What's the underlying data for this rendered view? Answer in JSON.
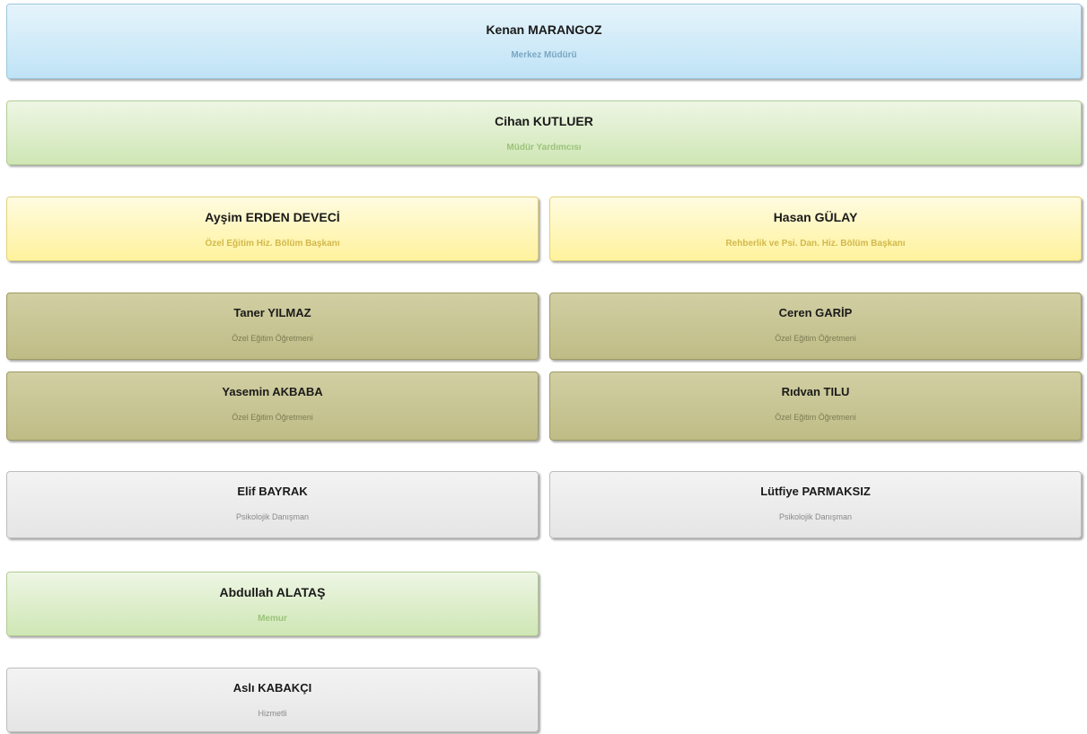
{
  "staff": [
    {
      "name": "Kenan MARANGOZ",
      "role": "Merkez Müdürü"
    },
    {
      "name": "Cihan KUTLUER",
      "role": "Müdür Yardımcısı"
    },
    {
      "name": "Ayşim ERDEN DEVECİ",
      "role": "Özel Eğitim Hiz. Bölüm Başkanı"
    },
    {
      "name": "Hasan GÜLAY",
      "role": "Rehberlik ve Psi. Dan. Hiz. Bölüm Başkanı"
    },
    {
      "name": "Taner YILMAZ",
      "role": "Özel Eğitim Öğretmeni"
    },
    {
      "name": "Ceren GARİP",
      "role": "Özel Eğitim Öğretmeni"
    },
    {
      "name": "Yasemin AKBABA",
      "role": "Özel Eğitim Öğretmeni"
    },
    {
      "name": "Rıdvan TILU",
      "role": "Özel Eğitim Öğretmeni"
    },
    {
      "name": "Elif BAYRAK",
      "role": "Psikolojik Danışman"
    },
    {
      "name": "Lütfiye PARMAKSIZ",
      "role": "Psikolojik Danışman"
    },
    {
      "name": "Abdullah ALATAŞ",
      "role": "Memur"
    },
    {
      "name": "Aslı KABAKÇI",
      "role": "Hizmetli"
    }
  ],
  "colors": {
    "director": "#bfe3f6",
    "assistant": "#cfe6b5",
    "department_head": "#fff29d",
    "teacher": "#bfbc86",
    "counselor": "#e5e5e5"
  }
}
